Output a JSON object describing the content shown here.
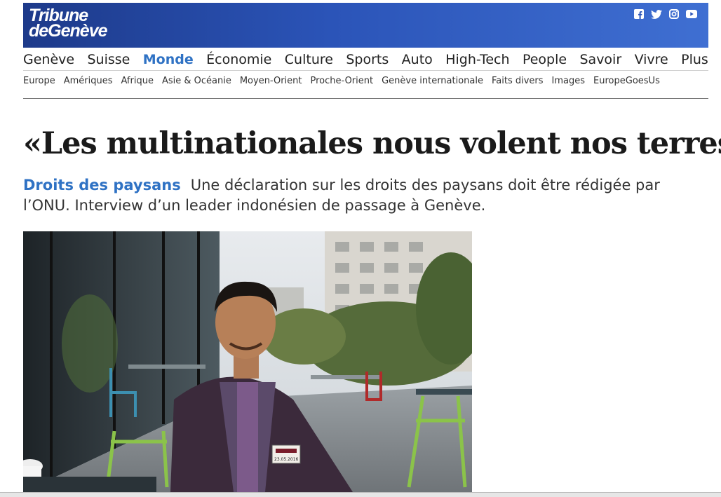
{
  "brand": {
    "line1": "Tribune",
    "line2": "deGenève"
  },
  "social": [
    "facebook-icon",
    "twitter-icon",
    "instagram-icon",
    "youtube-icon"
  ],
  "nav": {
    "main": [
      "Genève",
      "Suisse",
      "Monde",
      "Économie",
      "Culture",
      "Sports",
      "Auto",
      "High-Tech",
      "People",
      "Savoir",
      "Vivre",
      "Plus"
    ],
    "active": "Monde",
    "sub": [
      "Europe",
      "Amériques",
      "Afrique",
      "Asie & Océanie",
      "Moyen-Orient",
      "Proche-Orient",
      "Genève internationale",
      "Faits divers",
      "Images",
      "EuropeGoesUs"
    ]
  },
  "article": {
    "title": "«Les multinationales nous volent nos terres»",
    "kicker": "Droits des paysans",
    "lead": "Une déclaration sur les droits des paysans doit être rédigée par l’ONU. Interview d’un leader indonésien de passage à Genève."
  },
  "photo": {
    "badge_date": "23.05.2016"
  },
  "colors": {
    "brand_blue": "#2b54b8",
    "accent": "#2f72c4"
  }
}
